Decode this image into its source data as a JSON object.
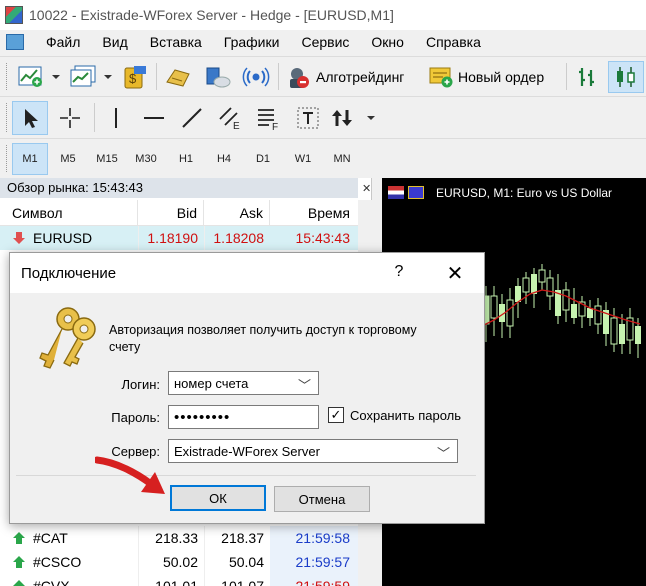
{
  "window": {
    "title": "10022 - Existrade-WForex Server - Hedge - [EURUSD,M1]"
  },
  "menu": {
    "items": [
      "Файл",
      "Вид",
      "Вставка",
      "Графики",
      "Сервис",
      "Окно",
      "Справка"
    ]
  },
  "toolbar": {
    "algo_trading_label": "Алготрейдинг",
    "new_order_label": "Новый ордер",
    "timeframes": [
      "M1",
      "M5",
      "M15",
      "M30",
      "H1",
      "H4",
      "D1",
      "W1",
      "MN"
    ],
    "active_timeframe": "M1"
  },
  "market_watch": {
    "title": "Обзор рынка: 15:43:43",
    "columns": {
      "symbol": "Символ",
      "bid": "Bid",
      "ask": "Ask",
      "time": "Время"
    },
    "rows": [
      {
        "symbol": "EURUSD",
        "bid": "1.18190",
        "ask": "1.18208",
        "time": "15:43:43",
        "direction": "down"
      },
      {
        "symbol": "#CAT",
        "bid": "218.33",
        "ask": "218.37",
        "time": "21:59:58",
        "direction": "up"
      },
      {
        "symbol": "#CSCO",
        "bid": "50.02",
        "ask": "50.04",
        "time": "21:59:57",
        "direction": "up"
      },
      {
        "symbol": "#CVX",
        "bid": "101.01",
        "ask": "101.07",
        "time": "21:59:59",
        "direction": "up"
      }
    ]
  },
  "chart": {
    "title": "EURUSD, M1:  Euro vs US Dollar",
    "background": "#000000",
    "candle_color": "#c6f3b0",
    "ma_color": "#d01818"
  },
  "dialog": {
    "title": "Подключение",
    "help_glyph": "?",
    "close_glyph": "✕",
    "description": "Авторизация позволяет получить доступ к торговому счету",
    "login_label": "Логин:",
    "login_value": "номер счета",
    "password_label": "Пароль:",
    "password_value": "•••••••••",
    "save_password_label": "Сохранить пароль",
    "save_password_checked": true,
    "server_label": "Сервер:",
    "server_value": "Existrade-WForex Server",
    "ok_label": "ОК",
    "cancel_label": "Отмена"
  },
  "icons": {
    "app": "metatrader-app-icon",
    "keys": "keys-icon",
    "red_arrow": "red-pointer-arrow"
  },
  "colors": {
    "price_red": "#d01010",
    "time_blue": "#1a3cc8",
    "selected_row": "#d7f0f5",
    "accent": "#0078d7"
  }
}
